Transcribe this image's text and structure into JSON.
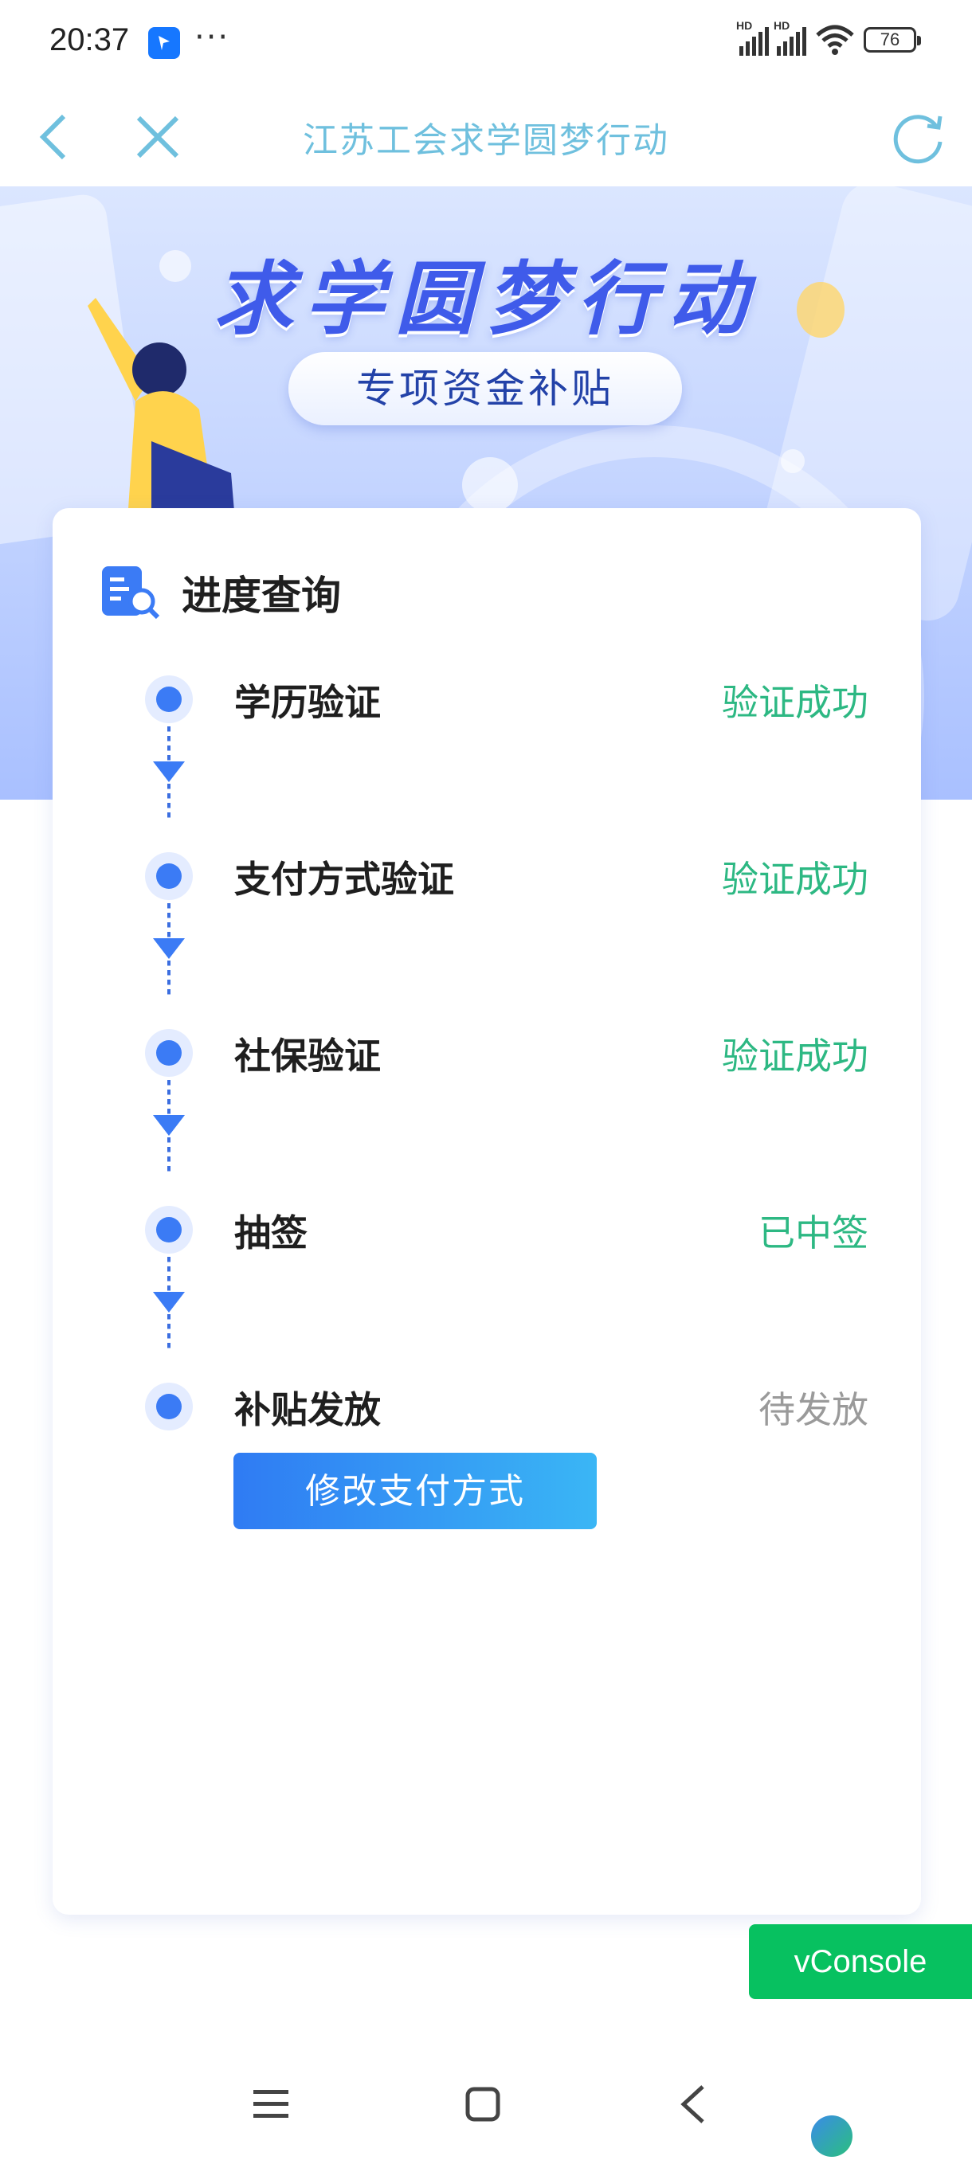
{
  "status_bar": {
    "time": "20:37",
    "more": "···",
    "signal_label_1": "HD",
    "signal_label_2": "HD",
    "battery": "76"
  },
  "title_bar": {
    "title": "江苏工会求学圆梦行动",
    "back_icon": "chevron-left-icon",
    "close_icon": "close-icon",
    "refresh_icon": "refresh-icon"
  },
  "hero": {
    "title": "求学圆梦行动",
    "subtitle": "专项资金补贴"
  },
  "card": {
    "title": "进度查询",
    "icon": "document-search-icon",
    "steps": [
      {
        "label": "学历验证",
        "status": "验证成功",
        "status_color": "#2db883"
      },
      {
        "label": "支付方式验证",
        "status": "验证成功",
        "status_color": "#2db883"
      },
      {
        "label": "社保验证",
        "status": "验证成功",
        "status_color": "#2db883"
      },
      {
        "label": "抽签",
        "status": "已中签",
        "status_color": "#2db883"
      },
      {
        "label": "补贴发放",
        "status": "待发放",
        "status_color": "#9a9a9a"
      }
    ],
    "action_button": "修改支付方式"
  },
  "vconsole": {
    "label": "vConsole"
  },
  "nav_bar": {
    "menu_icon": "menu-icon",
    "home_icon": "home-square-icon",
    "back_icon": "back-triangle-icon"
  },
  "colors": {
    "accent": "#3b7bf5",
    "success": "#2db883",
    "pending": "#9a9a9a",
    "title_bar_text": "#6fc0de",
    "vconsole": "#07c160"
  }
}
